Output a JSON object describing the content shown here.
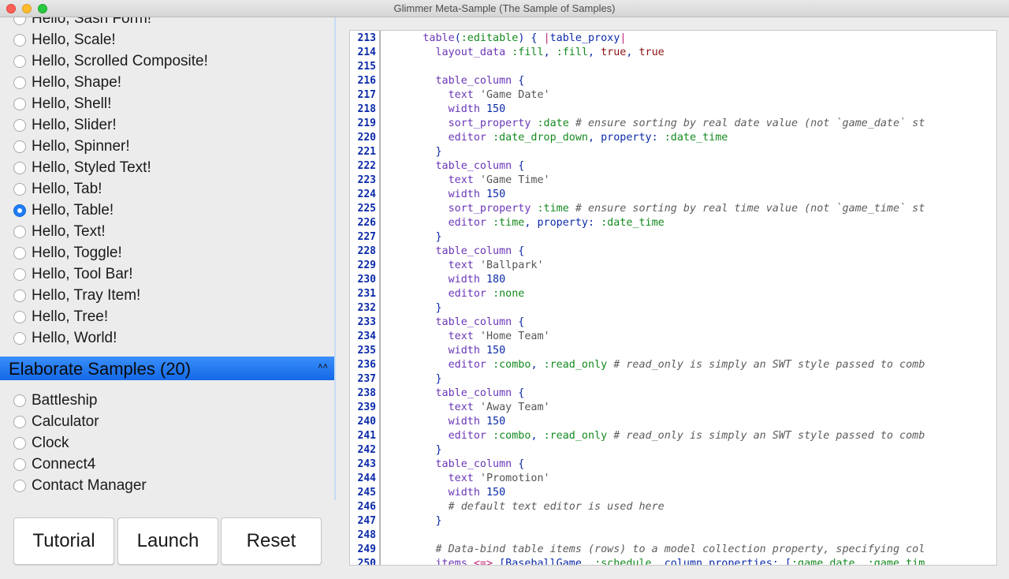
{
  "window": {
    "title": "Glimmer Meta-Sample (The Sample of Samples)"
  },
  "hello_samples": [
    {
      "label": "Hello, Sash Form!",
      "checked": false
    },
    {
      "label": "Hello, Scale!",
      "checked": false
    },
    {
      "label": "Hello, Scrolled Composite!",
      "checked": false
    },
    {
      "label": "Hello, Shape!",
      "checked": false
    },
    {
      "label": "Hello, Shell!",
      "checked": false
    },
    {
      "label": "Hello, Slider!",
      "checked": false
    },
    {
      "label": "Hello, Spinner!",
      "checked": false
    },
    {
      "label": "Hello, Styled Text!",
      "checked": false
    },
    {
      "label": "Hello, Tab!",
      "checked": false
    },
    {
      "label": "Hello, Table!",
      "checked": true
    },
    {
      "label": "Hello, Text!",
      "checked": false
    },
    {
      "label": "Hello, Toggle!",
      "checked": false
    },
    {
      "label": "Hello, Tool Bar!",
      "checked": false
    },
    {
      "label": "Hello, Tray Item!",
      "checked": false
    },
    {
      "label": "Hello, Tree!",
      "checked": false
    },
    {
      "label": "Hello, World!",
      "checked": false
    }
  ],
  "elaborate_section": {
    "title": "Elaborate Samples (20)",
    "collapse_icon": "chevron-double-up-icon"
  },
  "elaborate_samples": [
    {
      "label": "Battleship",
      "checked": false
    },
    {
      "label": "Calculator",
      "checked": false
    },
    {
      "label": "Clock",
      "checked": false
    },
    {
      "label": "Connect4",
      "checked": false
    },
    {
      "label": "Contact Manager",
      "checked": false
    }
  ],
  "buttons": {
    "tutorial": "Tutorial",
    "launch": "Launch",
    "reset": "Reset"
  },
  "editor": {
    "lines": [
      {
        "num": "213",
        "text": "      table(:editable) { |table_proxy|"
      },
      {
        "num": "214",
        "text": "        layout_data :fill, :fill, true, true"
      },
      {
        "num": "215",
        "text": ""
      },
      {
        "num": "216",
        "text": "        table_column {"
      },
      {
        "num": "217",
        "text": "          text 'Game Date'"
      },
      {
        "num": "218",
        "text": "          width 150"
      },
      {
        "num": "219",
        "text": "          sort_property :date # ensure sorting by real date value (not `game_date` st"
      },
      {
        "num": "220",
        "text": "          editor :date_drop_down, property: :date_time"
      },
      {
        "num": "221",
        "text": "        }"
      },
      {
        "num": "222",
        "text": "        table_column {"
      },
      {
        "num": "223",
        "text": "          text 'Game Time'"
      },
      {
        "num": "224",
        "text": "          width 150"
      },
      {
        "num": "225",
        "text": "          sort_property :time # ensure sorting by real time value (not `game_time` st"
      },
      {
        "num": "226",
        "text": "          editor :time, property: :date_time"
      },
      {
        "num": "227",
        "text": "        }"
      },
      {
        "num": "228",
        "text": "        table_column {"
      },
      {
        "num": "229",
        "text": "          text 'Ballpark'"
      },
      {
        "num": "230",
        "text": "          width 180"
      },
      {
        "num": "231",
        "text": "          editor :none"
      },
      {
        "num": "232",
        "text": "        }"
      },
      {
        "num": "233",
        "text": "        table_column {"
      },
      {
        "num": "234",
        "text": "          text 'Home Team'"
      },
      {
        "num": "235",
        "text": "          width 150"
      },
      {
        "num": "236",
        "text": "          editor :combo, :read_only # read_only is simply an SWT style passed to comb"
      },
      {
        "num": "237",
        "text": "        }"
      },
      {
        "num": "238",
        "text": "        table_column {"
      },
      {
        "num": "239",
        "text": "          text 'Away Team'"
      },
      {
        "num": "240",
        "text": "          width 150"
      },
      {
        "num": "241",
        "text": "          editor :combo, :read_only # read_only is simply an SWT style passed to comb"
      },
      {
        "num": "242",
        "text": "        }"
      },
      {
        "num": "243",
        "text": "        table_column {"
      },
      {
        "num": "244",
        "text": "          text 'Promotion'"
      },
      {
        "num": "245",
        "text": "          width 150"
      },
      {
        "num": "246",
        "text": "          # default text editor is used here"
      },
      {
        "num": "247",
        "text": "        }"
      },
      {
        "num": "248",
        "text": ""
      },
      {
        "num": "249",
        "text": "        # Data-bind table items (rows) to a model collection property, specifying col"
      },
      {
        "num": "250",
        "text": "        items <=> [BaseballGame, :schedule, column_properties: [:game_date, :game_tim"
      }
    ]
  }
}
